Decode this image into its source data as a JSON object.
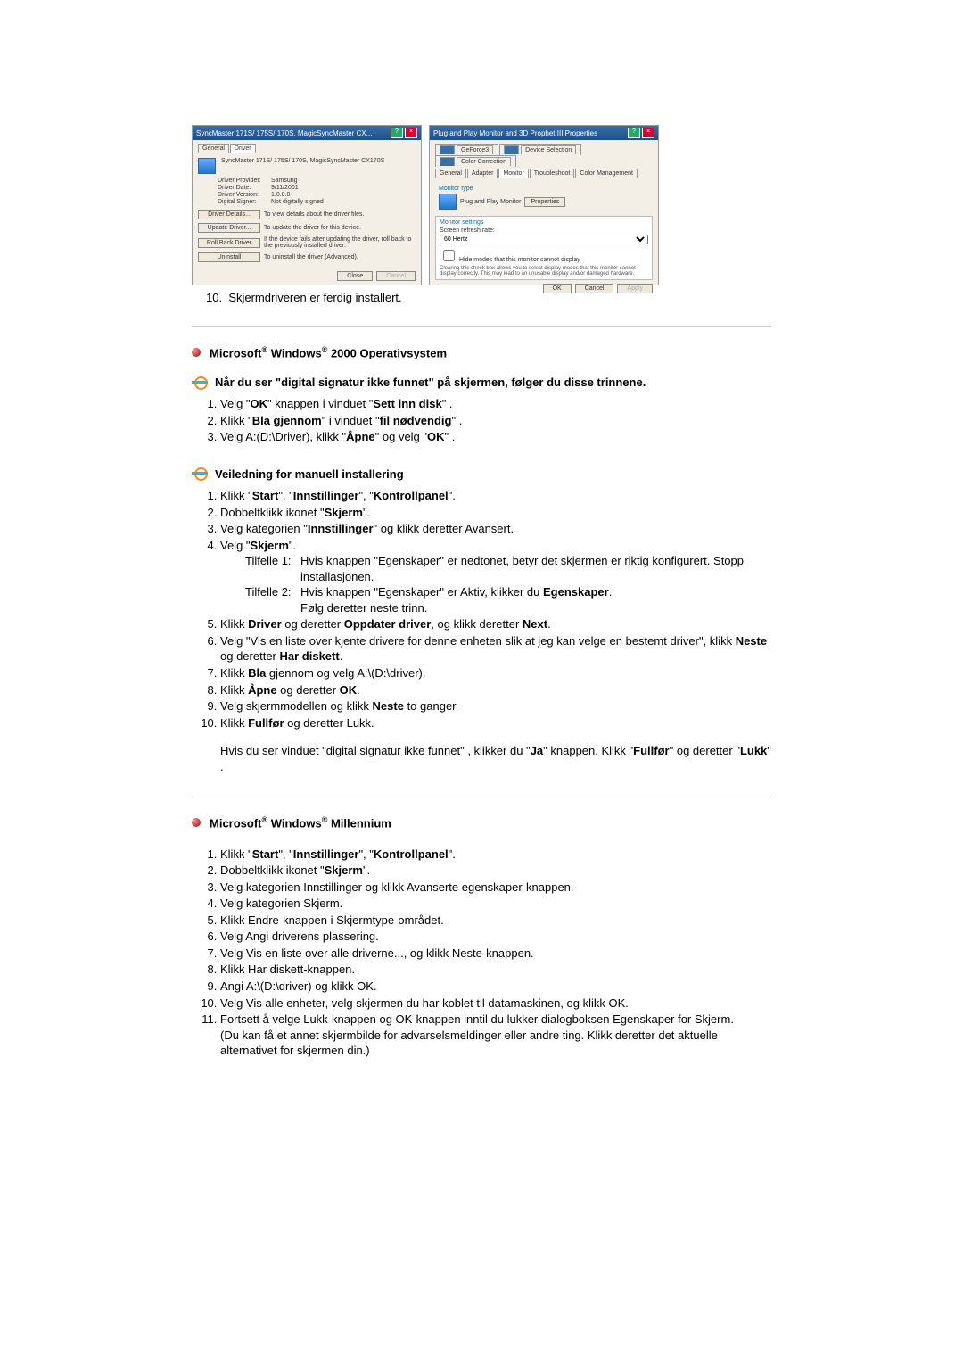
{
  "dialog1": {
    "title": "SyncMaster 171S/ 175S/ 170S, MagicSyncMaster CX...",
    "tabs": {
      "general": "General",
      "driver": "Driver"
    },
    "device": "SyncMaster 171S/ 175S/ 170S, MagicSyncMaster CX170S",
    "rows": {
      "provider_k": "Driver Provider:",
      "provider_v": "Samsung",
      "date_k": "Driver Date:",
      "date_v": "9/11/2001",
      "version_k": "Driver Version:",
      "version_v": "1.0.0.0",
      "signer_k": "Digital Signer:",
      "signer_v": "Not digitally signed"
    },
    "btns": {
      "details": "Driver Details...",
      "details_d": "To view details about the driver files.",
      "update": "Update Driver...",
      "update_d": "To update the driver for this device.",
      "rollback": "Roll Back Driver",
      "rollback_d": "If the device fails after updating the driver, roll back to the previously installed driver.",
      "uninstall": "Uninstall",
      "uninstall_d": "To uninstall the driver (Advanced)."
    },
    "close": "Close",
    "cancel": "Cancel"
  },
  "dialog2": {
    "title": "Plug and Play Monitor and 3D Prophet III Properties",
    "tabs": {
      "geforce": "GeForce3",
      "devsel": "Device Selection",
      "colorcorr": "Color Correction",
      "general": "General",
      "adapter": "Adapter",
      "monitor": "Monitor",
      "troubleshoot": "Troubleshoot",
      "colorman": "Color Management"
    },
    "montype_hdr": "Monitor type",
    "monname": "Plug and Play Monitor",
    "properties": "Properties",
    "settings_hdr": "Monitor settings",
    "refresh_lbl": "Screen refresh rate:",
    "refresh_val": "60 Hertz",
    "hide_cb": "Hide modes that this monitor cannot display",
    "hide_note": "Clearing this check box allows you to select display modes that this monitor cannot display correctly. This may lead to an unusable display and/or damaged hardware.",
    "ok": "OK",
    "cancel": "Cancel",
    "apply": "Apply"
  },
  "step10": {
    "num": "10.",
    "text": "Skjermdriveren er ferdig installert."
  },
  "win2000": {
    "title_pre": "Microsoft",
    "title_mid": " Windows",
    "title_post": " 2000 Operativsystem",
    "sig_intro": "Når du ser \"digital signatur ikke funnet\" på skjermen, følger du disse trinnene.",
    "s1": {
      "a": "Velg \"",
      "ok": "OK",
      "b": "\" knappen i vinduet \"",
      "w": "Sett inn disk",
      "c": "\" ."
    },
    "s2": {
      "a": "Klikk \"",
      "bla": "Bla gjennom",
      "b": "\" i vinduet \"",
      "w": "fil nødvendig",
      "c": "\" ."
    },
    "s3": {
      "a": "Velg A:(D:\\Driver), klikk \"",
      "apne": "Åpne",
      "b": "\" og velg \"",
      "ok": "OK",
      "c": "\" ."
    },
    "man_title": "Veiledning for manuell installering",
    "m1": {
      "a": "Klikk \"",
      "s": "Start",
      "b": "\", \"",
      "i": "Innstillinger",
      "c": "\", \"",
      "k": "Kontrollpanel",
      "d": "\"."
    },
    "m2": {
      "a": "Dobbeltklikk ikonet \"",
      "s": "Skjerm",
      "b": "\"."
    },
    "m3": {
      "a": "Velg kategorien \"",
      "i": "Innstillinger",
      "b": "\" og klikk deretter Avansert."
    },
    "m4": {
      "a": "Velg \"",
      "s": "Skjerm",
      "b": "\"."
    },
    "t1_lbl": "Tilfelle 1:",
    "t1": "Hvis knappen \"Egenskaper\" er nedtonet, betyr det skjermen er riktig konfigurert. Stopp installasjonen.",
    "t2_lbl": "Tilfelle 2:",
    "t2a": "Hvis knappen \"Egenskaper\" er Aktiv, klikker du ",
    "t2b": "Egenskaper",
    "t2c": ".",
    "t2d": "Følg deretter neste trinn.",
    "m5": {
      "a": "Klikk ",
      "d": "Driver",
      "b": " og deretter ",
      "o": "Oppdater driver",
      "c": ", og klikk deretter ",
      "n": "Next",
      "e": "."
    },
    "m6": {
      "a": "Velg \"Vis en liste over kjente drivere for denne enheten slik at jeg kan velge en bestemt driver\", klikk ",
      "n": "Neste",
      "b": " og deretter ",
      "h": "Har diskett",
      "c": "."
    },
    "m7": {
      "a": "Klikk ",
      "b": "Bla",
      "c": " gjennom og velg A:\\(D:\\driver)."
    },
    "m8": {
      "a": "Klikk ",
      "ap": "Åpne",
      "b": " og deretter ",
      "ok": "OK",
      "c": "."
    },
    "m9": {
      "a": "Velg skjermmodellen og klikk ",
      "n": "Neste",
      "b": " to ganger."
    },
    "m10": {
      "a": "Klikk ",
      "f": "Fullfør",
      "b": " og deretter Lukk."
    },
    "mnote": {
      "a": "Hvis du ser vinduet \"digital signatur ikke funnet\" , klikker du \"",
      "ja": "Ja",
      "b": "\" knappen. Klikk \"",
      "f": "Fullfør",
      "c": "\" og deretter \"",
      "l": "Lukk",
      "d": "\" ."
    }
  },
  "winme": {
    "title_pre": "Microsoft",
    "title_mid": " Windows",
    "title_post": " Millennium",
    "s1": {
      "a": "Klikk \"",
      "s": "Start",
      "b": "\", \"",
      "i": "Innstillinger",
      "c": "\", \"",
      "k": "Kontrollpanel",
      "d": "\"."
    },
    "s2": {
      "a": "Dobbeltklikk ikonet \"",
      "sk": "Skjerm",
      "b": "\"."
    },
    "s3": "Velg kategorien Innstillinger og klikk Avanserte egenskaper-knappen.",
    "s4": "Velg kategorien Skjerm.",
    "s5": "Klikk Endre-knappen i Skjermtype-området.",
    "s6": "Velg Angi driverens plassering.",
    "s7": "Velg Vis en liste over alle driverne..., og klikk Neste-knappen.",
    "s8": "Klikk Har diskett-knappen.",
    "s9": "Angi A:\\(D:\\driver) og klikk OK.",
    "s10": "Velg Vis alle enheter, velg skjermen du har koblet til datamaskinen, og klikk OK.",
    "s11a": "Fortsett å velge Lukk-knappen og OK-knappen inntil du lukker dialogboksen Egenskaper for Skjerm.",
    "s11b": "(Du kan få et annet skjermbilde for advarselsmeldinger eller andre ting. Klikk deretter det aktuelle alternativet for skjermen din.)"
  }
}
